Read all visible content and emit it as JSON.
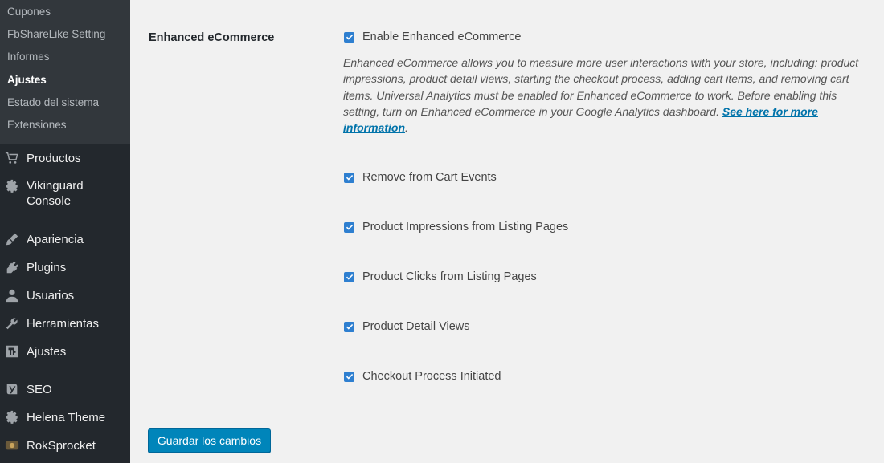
{
  "sidebar": {
    "submenu": [
      "Cupones",
      "FbShareLike Setting",
      "Informes",
      "Ajustes",
      "Estado del sistema",
      "Extensiones"
    ],
    "current_submenu": "Ajustes",
    "menu": {
      "productos": "Productos",
      "vikinguard_line1": "Vikinguard",
      "vikinguard_line2": "Console",
      "apariencia": "Apariencia",
      "plugins": "Plugins",
      "usuarios": "Usuarios",
      "herramientas": "Herramientas",
      "ajustes": "Ajustes",
      "seo": "SEO",
      "helena": "Helena Theme",
      "rok": "RokSprocket"
    },
    "icons": [
      "cart-icon",
      "gear-icon",
      "brush-icon",
      "plugin-icon",
      "user-icon",
      "wrench-icon",
      "settings-icon",
      "seo-icon",
      "gear-icon",
      "rocket-icon"
    ],
    "colors": {
      "background": "#23282d",
      "submenu_background": "#32373c",
      "text": "#eeeeee"
    }
  },
  "main": {
    "section_label": "Enhanced eCommerce",
    "enable_label": "Enable Enhanced eCommerce",
    "description": "Enhanced eCommerce allows you to measure more user interactions with your store, including: product impressions, product detail views, starting the checkout process, adding cart items, and removing cart items. Universal Analytics must be enabled for Enhanced eCommerce to work. Before enabling this setting, turn on Enhanced eCommerce in your Google Analytics dashboard. ",
    "description_link": "See here for more information",
    "description_end": ".",
    "options": [
      {
        "label": "Remove from Cart Events",
        "checked": true
      },
      {
        "label": "Product Impressions from Listing Pages",
        "checked": true
      },
      {
        "label": "Product Clicks from Listing Pages",
        "checked": true
      },
      {
        "label": "Product Detail Views",
        "checked": true
      },
      {
        "label": "Checkout Process Initiated",
        "checked": true
      }
    ],
    "save_button": "Guardar los cambios",
    "colors": {
      "checkbox": "#2e7fd0",
      "link": "#0073aa",
      "button": "#0085ba"
    }
  }
}
